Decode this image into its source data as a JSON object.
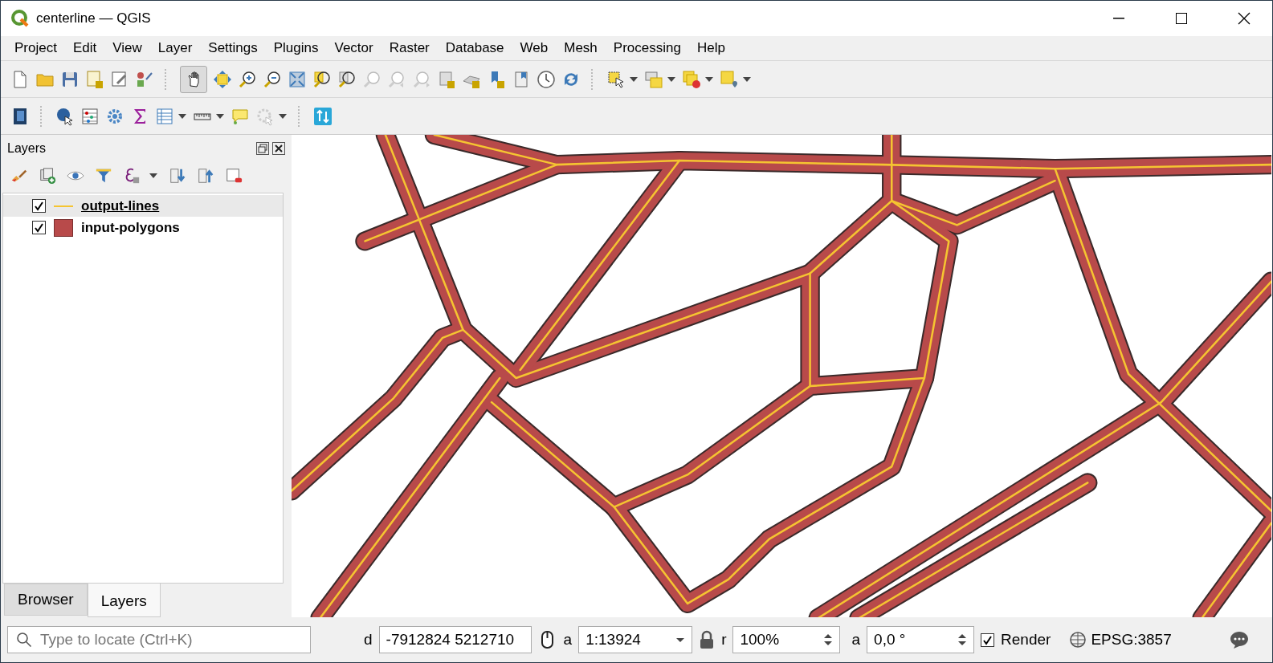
{
  "window": {
    "title": "centerline — QGIS"
  },
  "menu": [
    "Project",
    "Edit",
    "View",
    "Layer",
    "Settings",
    "Plugins",
    "Vector",
    "Raster",
    "Database",
    "Web",
    "Mesh",
    "Processing",
    "Help"
  ],
  "pan_tool": {
    "selected": true
  },
  "layers_panel": {
    "title": "Layers",
    "layers": [
      {
        "name": "output-lines",
        "kind": "line",
        "color": "#f5c431",
        "checked": true,
        "selected": true
      },
      {
        "name": "input-polygons",
        "kind": "polygon",
        "color": "#b84a4a",
        "checked": true,
        "selected": false
      }
    ]
  },
  "dock_tabs": [
    {
      "label": "Browser",
      "selected": false
    },
    {
      "label": "Layers",
      "selected": true
    }
  ],
  "status_bar": {
    "locator": {
      "placeholder": "Type to locate (Ctrl+K)"
    },
    "coordinate_label": "d",
    "coordinate": "-7912824  5212710",
    "scale_label": "a",
    "scale": "1:13924",
    "magnifier_label": "r",
    "magnifier": "100%",
    "rotation_label": "a",
    "rotation": "0,0 °",
    "render": {
      "label": "Render",
      "checked": true
    },
    "crs": "EPSG:3857"
  }
}
